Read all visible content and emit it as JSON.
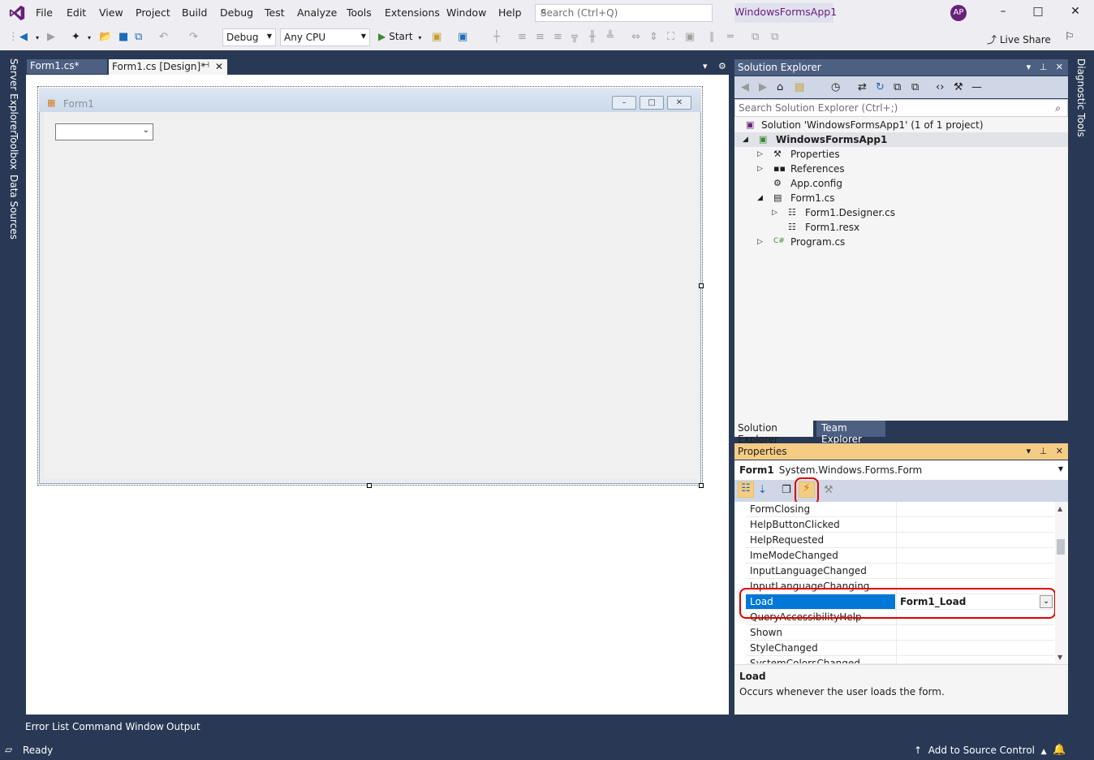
{
  "menu": {
    "items": [
      "File",
      "Edit",
      "View",
      "Project",
      "Build",
      "Debug",
      "Test",
      "Analyze",
      "Tools",
      "Extensions",
      "Window",
      "Help"
    ],
    "search_placeholder": "Search (Ctrl+Q)",
    "app_title": "WindowsFormsApp1",
    "avatar_initials": "AP"
  },
  "toolbar": {
    "config": "Debug",
    "platform": "Any CPU",
    "start_label": "Start",
    "live_share": "Live Share"
  },
  "side_tabs": {
    "left": [
      "Server Explorer",
      "Toolbox",
      "Data Sources"
    ],
    "right": [
      "Diagnostic Tools"
    ]
  },
  "doc_tabs": [
    {
      "label": "Form1.cs*"
    },
    {
      "label": "Form1.cs [Design]*"
    }
  ],
  "designer": {
    "form_title": "Form1"
  },
  "solution_explorer": {
    "title": "Solution Explorer",
    "search_placeholder": "Search Solution Explorer (Ctrl+;)",
    "tree": [
      {
        "label": "Solution 'WindowsFormsApp1' (1 of 1 project)",
        "icon": "solution-icon"
      },
      {
        "label": "WindowsFormsApp1",
        "icon": "csharp-project-icon"
      },
      {
        "label": "Properties",
        "icon": "wrench-icon"
      },
      {
        "label": "References",
        "icon": "references-icon"
      },
      {
        "label": "App.config",
        "icon": "config-icon"
      },
      {
        "label": "Form1.cs",
        "icon": "form-icon"
      },
      {
        "label": "Form1.Designer.cs",
        "icon": "designer-file-icon"
      },
      {
        "label": "Form1.resx",
        "icon": "resx-icon"
      },
      {
        "label": "Program.cs",
        "icon": "csharp-file-icon"
      }
    ],
    "tabs": [
      "Solution Explorer",
      "Team Explorer"
    ]
  },
  "properties": {
    "title": "Properties",
    "object_name": "Form1",
    "object_type": "System.Windows.Forms.Form",
    "events": [
      {
        "name": "FormClosing",
        "value": ""
      },
      {
        "name": "HelpButtonClicked",
        "value": ""
      },
      {
        "name": "HelpRequested",
        "value": ""
      },
      {
        "name": "ImeModeChanged",
        "value": ""
      },
      {
        "name": "InputLanguageChanged",
        "value": ""
      },
      {
        "name": "InputLanguageChanging",
        "value": ""
      },
      {
        "name": "Load",
        "value": "Form1_Load"
      },
      {
        "name": "QueryAccessibilityHelp",
        "value": ""
      },
      {
        "name": "Shown",
        "value": ""
      },
      {
        "name": "StyleChanged",
        "value": ""
      },
      {
        "name": "SystemColorsChanged",
        "value": ""
      }
    ],
    "desc_title": "Load",
    "desc_text": "Occurs whenever the user loads the form."
  },
  "bottom_tabs": [
    "Error List",
    "Command Window",
    "Output"
  ],
  "status": {
    "ready": "Ready",
    "source_control": "Add to Source Control"
  },
  "colors": {
    "accent_purple": "#68217a",
    "frame": "#293955",
    "selection_blue": "#0078d7",
    "properties_header": "#f5cc84",
    "annotation_red": "#e00000"
  }
}
